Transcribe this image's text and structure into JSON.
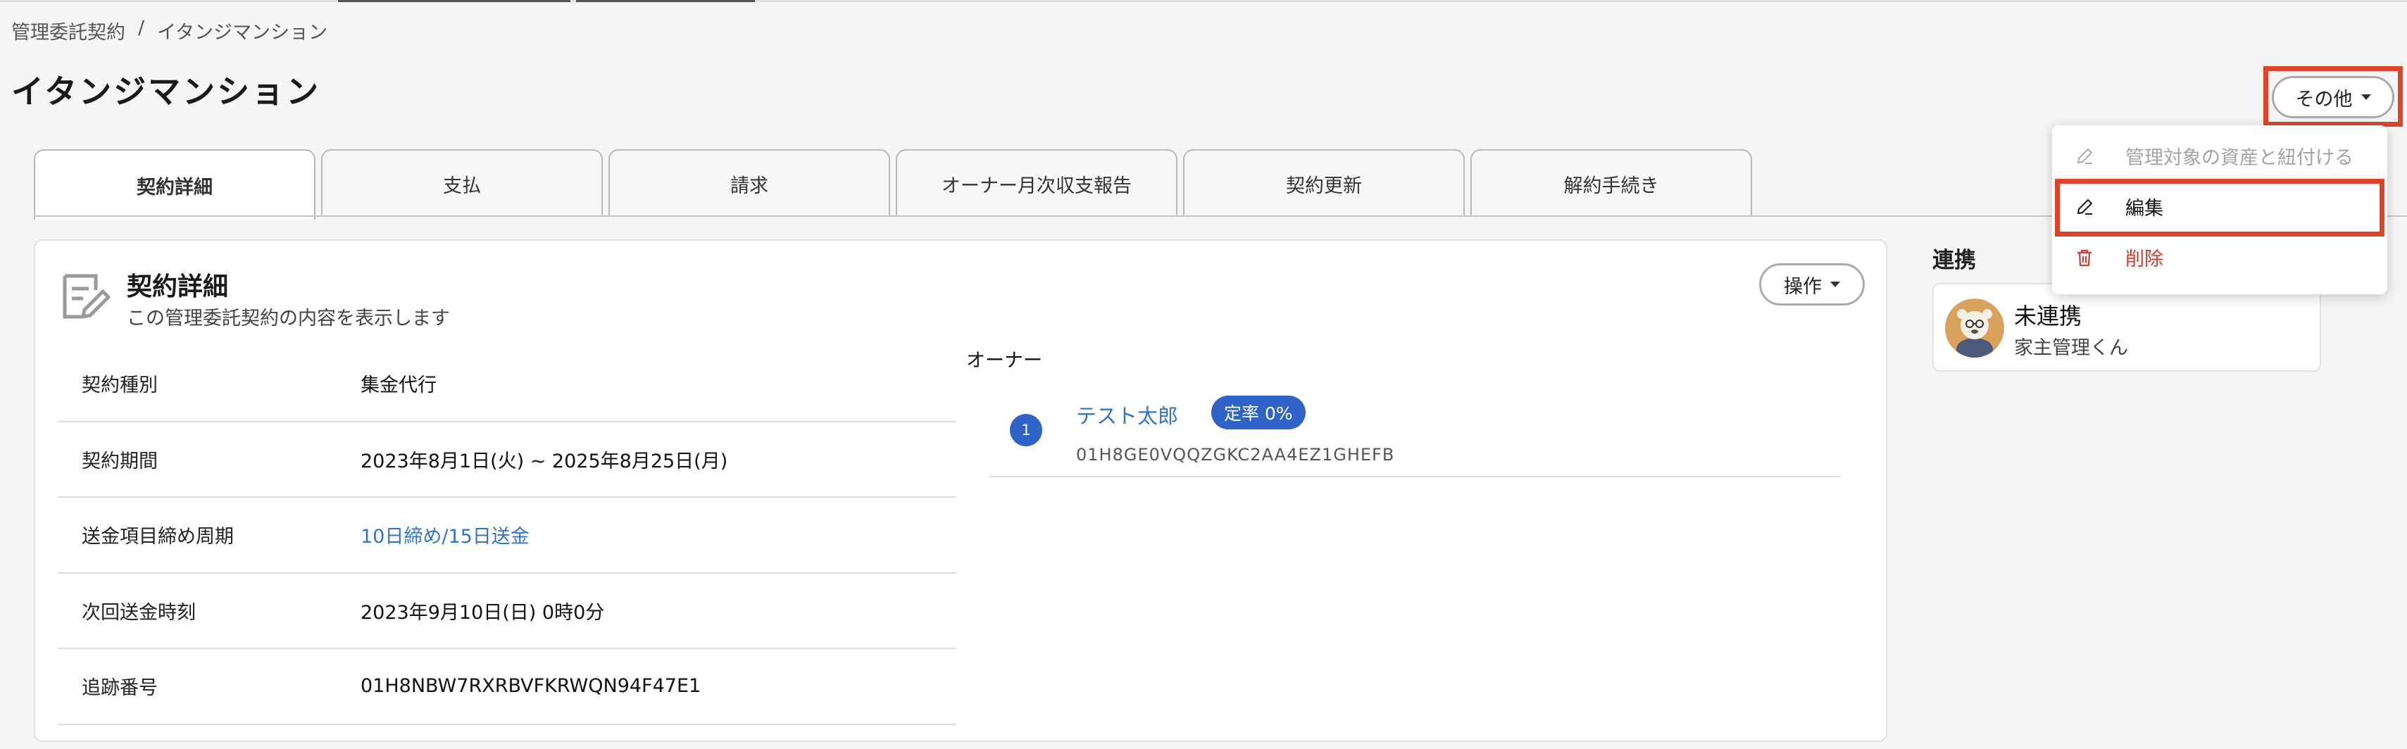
{
  "breadcrumb": {
    "parent": "管理委託契約",
    "separator": "/",
    "current": "イタンジマンション"
  },
  "page_title": "イタンジマンション",
  "more_menu": {
    "button_label": "その他",
    "items": [
      {
        "label": "管理対象の資産と紐付ける",
        "icon": "pencil-icon",
        "state": "disabled"
      },
      {
        "label": "編集",
        "icon": "pencil-icon",
        "state": "highlighted"
      },
      {
        "label": "削除",
        "icon": "trash-icon",
        "state": "danger"
      }
    ]
  },
  "tabs": [
    {
      "label": "契約詳細",
      "active": true
    },
    {
      "label": "支払"
    },
    {
      "label": "請求"
    },
    {
      "label": "オーナー月次収支報告"
    },
    {
      "label": "契約更新"
    },
    {
      "label": "解約手続き"
    }
  ],
  "contract": {
    "title": "契約詳細",
    "subtitle": "この管理委託契約の内容を表示します",
    "ops_label": "操作",
    "rows": [
      {
        "label": "契約種別",
        "value": "集金代行"
      },
      {
        "label": "契約期間",
        "value": "2023年8月1日(火) ~ 2025年8月25日(月)"
      },
      {
        "label": "送金項目締め周期",
        "value": "10日締め/15日送金",
        "link": true
      },
      {
        "label": "次回送金時刻",
        "value": "2023年9月10日(日) 0時0分"
      },
      {
        "label": "追跡番号",
        "value": "01H8NBW7RXRBVFKRWQN94F47E1"
      }
    ]
  },
  "owner": {
    "section_label": "オーナー",
    "index": "1",
    "name": "テスト太郎",
    "badge": "定率 0%",
    "id": "01H8GE0VQQZGKC2AA4EZ1GHEFB"
  },
  "integration": {
    "title": "連携",
    "status": "未連携",
    "service": "家主管理くん"
  },
  "colors": {
    "link": "#2f72d6",
    "badge": "#2f63c8",
    "danger": "#d73a2a",
    "highlight": "#e04427"
  }
}
